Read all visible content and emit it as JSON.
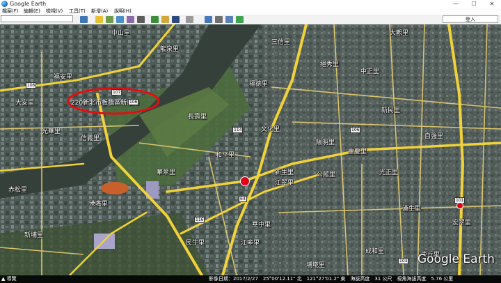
{
  "window": {
    "title": "Google Earth",
    "minimize": "—",
    "maximize": "☐",
    "close": "✕"
  },
  "menu": [
    "檔案(F)",
    "編輯(E)",
    "檢視(V)",
    "工具(T)",
    "新增(A)",
    "說明(H)"
  ],
  "toolbar": {
    "search_value": "",
    "login_label": "登入",
    "tools": [
      "sidebar-toggle-icon",
      "placemark-icon",
      "polygon-icon",
      "path-icon",
      "image-overlay-icon",
      "record-tour-icon",
      "historical-imagery-icon",
      "sun-icon",
      "planets-icon",
      "ruler-icon",
      "email-icon",
      "print-icon",
      "save-image-icon",
      "google-maps-icon"
    ]
  },
  "map": {
    "annotation": "220新北市板橋區新站路",
    "places": [
      "中山里",
      "龍泉里",
      "三信里",
      "大觀里",
      "挹秀里",
      "中正里",
      "福德里",
      "福安里",
      "大安里",
      "新民里",
      "長壽里",
      "文化里",
      "光華里",
      "信義里",
      "陽明里",
      "自強里",
      "和平里",
      "重慶里",
      "新生里",
      "公館里",
      "光正里",
      "華翠里",
      "赤松里",
      "港嘴里",
      "江翠里",
      "漢生里",
      "華中里",
      "新埔里",
      "民生里",
      "江寧里",
      "宏翠里",
      "成和里",
      "埔墘里",
      "東丘里"
    ],
    "shields": [
      "107",
      "106",
      "114",
      "106",
      "64",
      "116",
      "101",
      "103",
      "106"
    ],
    "watermark": "Google Earth"
  },
  "status": {
    "left": "▲ 導覽",
    "text": "影像日期：2017/2/27　25°00'12.11\" 北　121°27'01.2\" 東　海拔高度　31 公尺　視角海拔高度　5.76 公里"
  },
  "colors": {
    "river": "#36403a",
    "road_major": "#f0d23a",
    "road_minor": "#e8d070",
    "annotation_ring": "#e01010"
  }
}
